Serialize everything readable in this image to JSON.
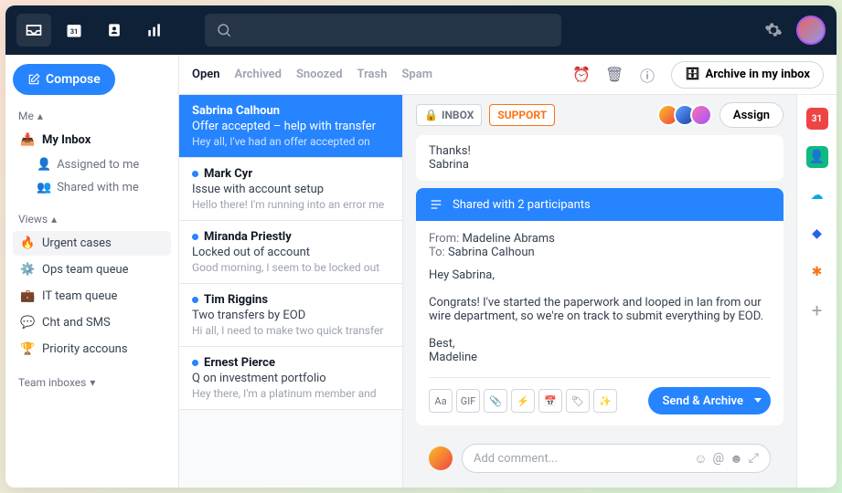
{
  "topbar": {
    "nav": [
      "inbox",
      "calendar",
      "contacts",
      "analytics"
    ]
  },
  "sidebar": {
    "compose": "Compose",
    "me_label": "Me",
    "my_inbox": "My Inbox",
    "assigned": "Assigned to me",
    "shared": "Shared with me",
    "views_label": "Views",
    "views": [
      {
        "icon": "🔥",
        "label": "Urgent cases"
      },
      {
        "icon": "⚙️",
        "label": "Ops team queue"
      },
      {
        "icon": "💼",
        "label": "IT team queue"
      },
      {
        "icon": "💬",
        "label": "Cht and SMS"
      },
      {
        "icon": "🏆",
        "label": "Priority accouns"
      }
    ],
    "team_label": "Team inboxes"
  },
  "tabs": {
    "open": "Open",
    "archived": "Archived",
    "snoozed": "Snoozed",
    "trash": "Trash",
    "spam": "Spam",
    "archive_btn": "Archive in my inbox"
  },
  "threads": [
    {
      "from": "Sabrina Calhoun",
      "subj": "Offer accepted – help with transfer",
      "prev": "Hey all, I've had an offer accepted on",
      "sel": true
    },
    {
      "from": "Mark Cyr",
      "subj": "Issue with account setup",
      "prev": "Hello there! I'm running into an error me"
    },
    {
      "from": "Miranda Priestly",
      "subj": "Locked out of account",
      "prev": "Good morning, I seem to be locked out"
    },
    {
      "from": "Tim Riggins",
      "subj": "Two transfers by EOD",
      "prev": "Hi all, I need to make two quick transfer"
    },
    {
      "from": "Ernest Pierce",
      "subj": "Q on investment portfolio",
      "prev": "Hey there, I'm a platinum member and"
    }
  ],
  "detail": {
    "tag_inbox": "INBOX",
    "tag_support": "SUPPORT",
    "assign": "Assign",
    "prior_msg_line1": "Thanks!",
    "prior_msg_line2": "Sabrina",
    "share_bar": "Shared with 2 participants",
    "from_label": "From:",
    "from_value": "Madeline Abrams",
    "to_label": "To:",
    "to_value": "Sabrina Calhoun",
    "greeting": "Hey Sabrina,",
    "body": "Congrats! I've started the paperwork and looped in Ian from our wire department, so we're on track to submit everything by EOD.",
    "signoff1": "Best,",
    "signoff2": "Madeline",
    "send": "Send & Archive",
    "comment_placeholder": "Add comment..."
  }
}
